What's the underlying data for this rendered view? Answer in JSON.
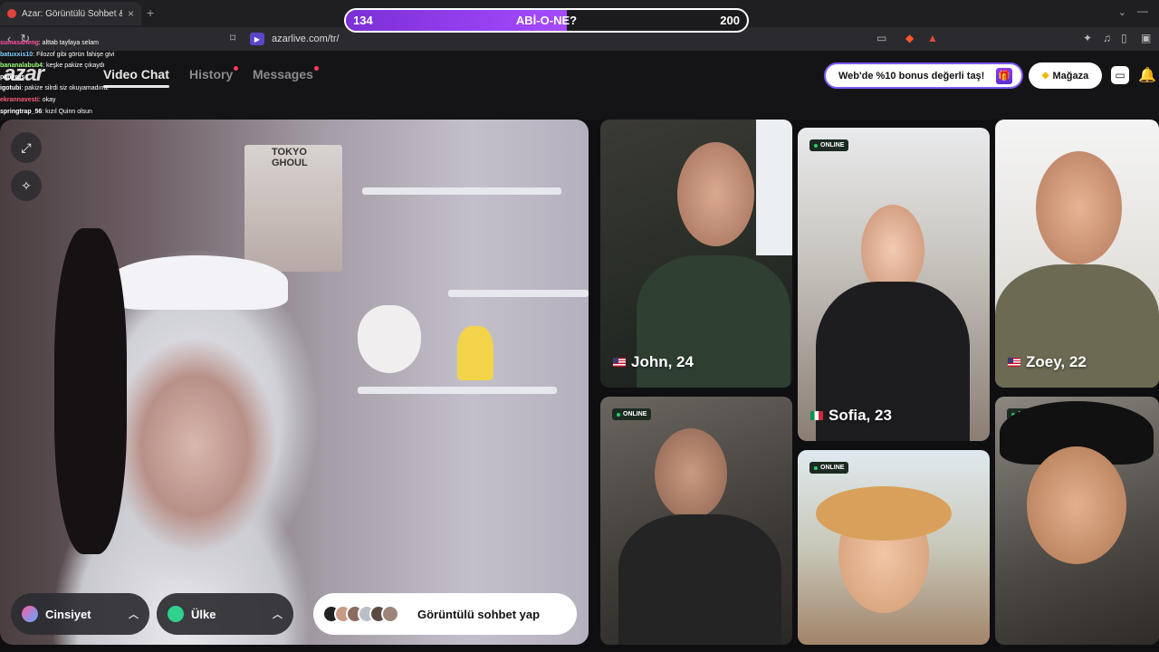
{
  "browser": {
    "tab_title": "Azar: Görüntülü Sohbet & Yen",
    "tab_close": "×",
    "new_tab": "+",
    "url": "azarlive.com/tr/"
  },
  "stream_goal": {
    "start": "134",
    "label": "ABİ-O-NE?",
    "end": "200",
    "progress_fraction": 0.55
  },
  "chat": [
    {
      "user": "sumasaheng",
      "msg": ": alttab tayfaya selam",
      "color": "#ff4fa3"
    },
    {
      "user": "batuxxis10",
      "msg": ": Filozof gibi görün fahişe givi",
      "color": "#7fd3ff"
    },
    {
      "user": "bananalabub4",
      "msg": ": keşke pakize çıkaydı",
      "color": "#9dff7a"
    },
    {
      "user": "papyrus",
      "msg": "",
      "color": "#ffffff"
    },
    {
      "user": "igotubi",
      "msg": ": pakize silrdi siz okuyamadınız",
      "color": "#ffffff"
    },
    {
      "user": "ekrannavesti",
      "msg": ": okay",
      "color": "#ff5c7a"
    },
    {
      "user": "springtrap_56",
      "msg": ": kızıl Quinn olsun",
      "color": "#ffffff"
    }
  ],
  "site": {
    "logo": "azar",
    "nav": [
      {
        "label": "Video Chat",
        "active": true,
        "dot": false
      },
      {
        "label": "History",
        "active": false,
        "dot": true
      },
      {
        "label": "Messages",
        "active": false,
        "dot": true
      }
    ],
    "promo_text": "Web'de %10 bonus değerli taş!",
    "shop_label": "Mağaza"
  },
  "video": {
    "poster_text": "TOKYO GHOUL",
    "gender_label": "Cinsiyet",
    "country_label": "Ülke",
    "start_label": "Görüntülü sohbet yap"
  },
  "cards": [
    {
      "name": "John, 24",
      "flag": "us",
      "online": false
    },
    {
      "name": "Sofia, 23",
      "flag": "it",
      "online": true
    },
    {
      "name": "Zoey, 22",
      "flag": "us",
      "online": false
    },
    {
      "name": "",
      "flag": "",
      "online": true
    },
    {
      "name": "",
      "flag": "",
      "online": true
    },
    {
      "name": "",
      "flag": "",
      "online": true
    }
  ],
  "online_label": "ONLINE"
}
